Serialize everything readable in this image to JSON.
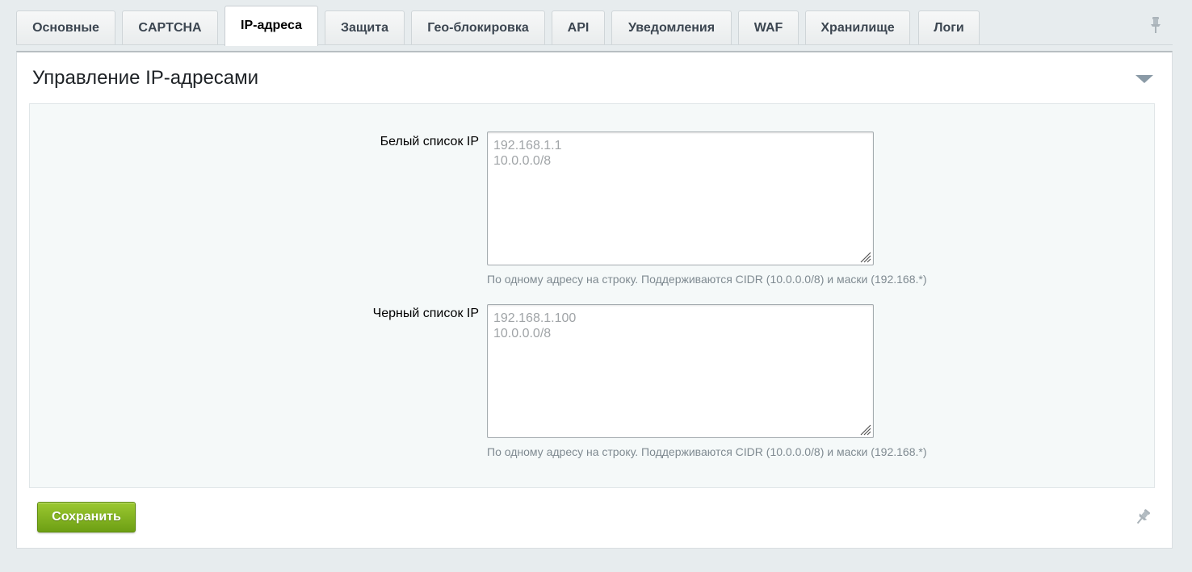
{
  "tabs": [
    {
      "label": "Основные"
    },
    {
      "label": "CAPTCHA"
    },
    {
      "label": "IP-адреса",
      "active": true
    },
    {
      "label": "Защита"
    },
    {
      "label": "Гео-блокировка"
    },
    {
      "label": "API"
    },
    {
      "label": "Уведомления"
    },
    {
      "label": "WAF"
    },
    {
      "label": "Хранилище"
    },
    {
      "label": "Логи"
    }
  ],
  "panel": {
    "title": "Управление IP-адресами"
  },
  "whitelist": {
    "label": "Белый список IP",
    "value": "",
    "placeholder_lines": [
      "192.168.1.1",
      "10.0.0.0/8"
    ],
    "hint": "По одному адресу на строку. Поддерживаются CIDR (10.0.0.0/8) и маски (192.168.*)"
  },
  "blacklist": {
    "label": "Черный список IP",
    "value": "",
    "placeholder_lines": [
      "192.168.1.100",
      "10.0.0.0/8"
    ],
    "hint": "По одному адресу на строку. Поддерживаются CIDR (10.0.0.0/8) и маски (192.168.*)"
  },
  "actions": {
    "save_label": "Сохранить"
  },
  "icons": {
    "top_right": "pin-icon",
    "panel_toggle": "collapse-arrow-icon",
    "bottom_right": "pin-icon"
  },
  "colors": {
    "save_button": "#7aab1c",
    "page_background": "#e7ecee",
    "form_background": "#f5f9f9"
  }
}
